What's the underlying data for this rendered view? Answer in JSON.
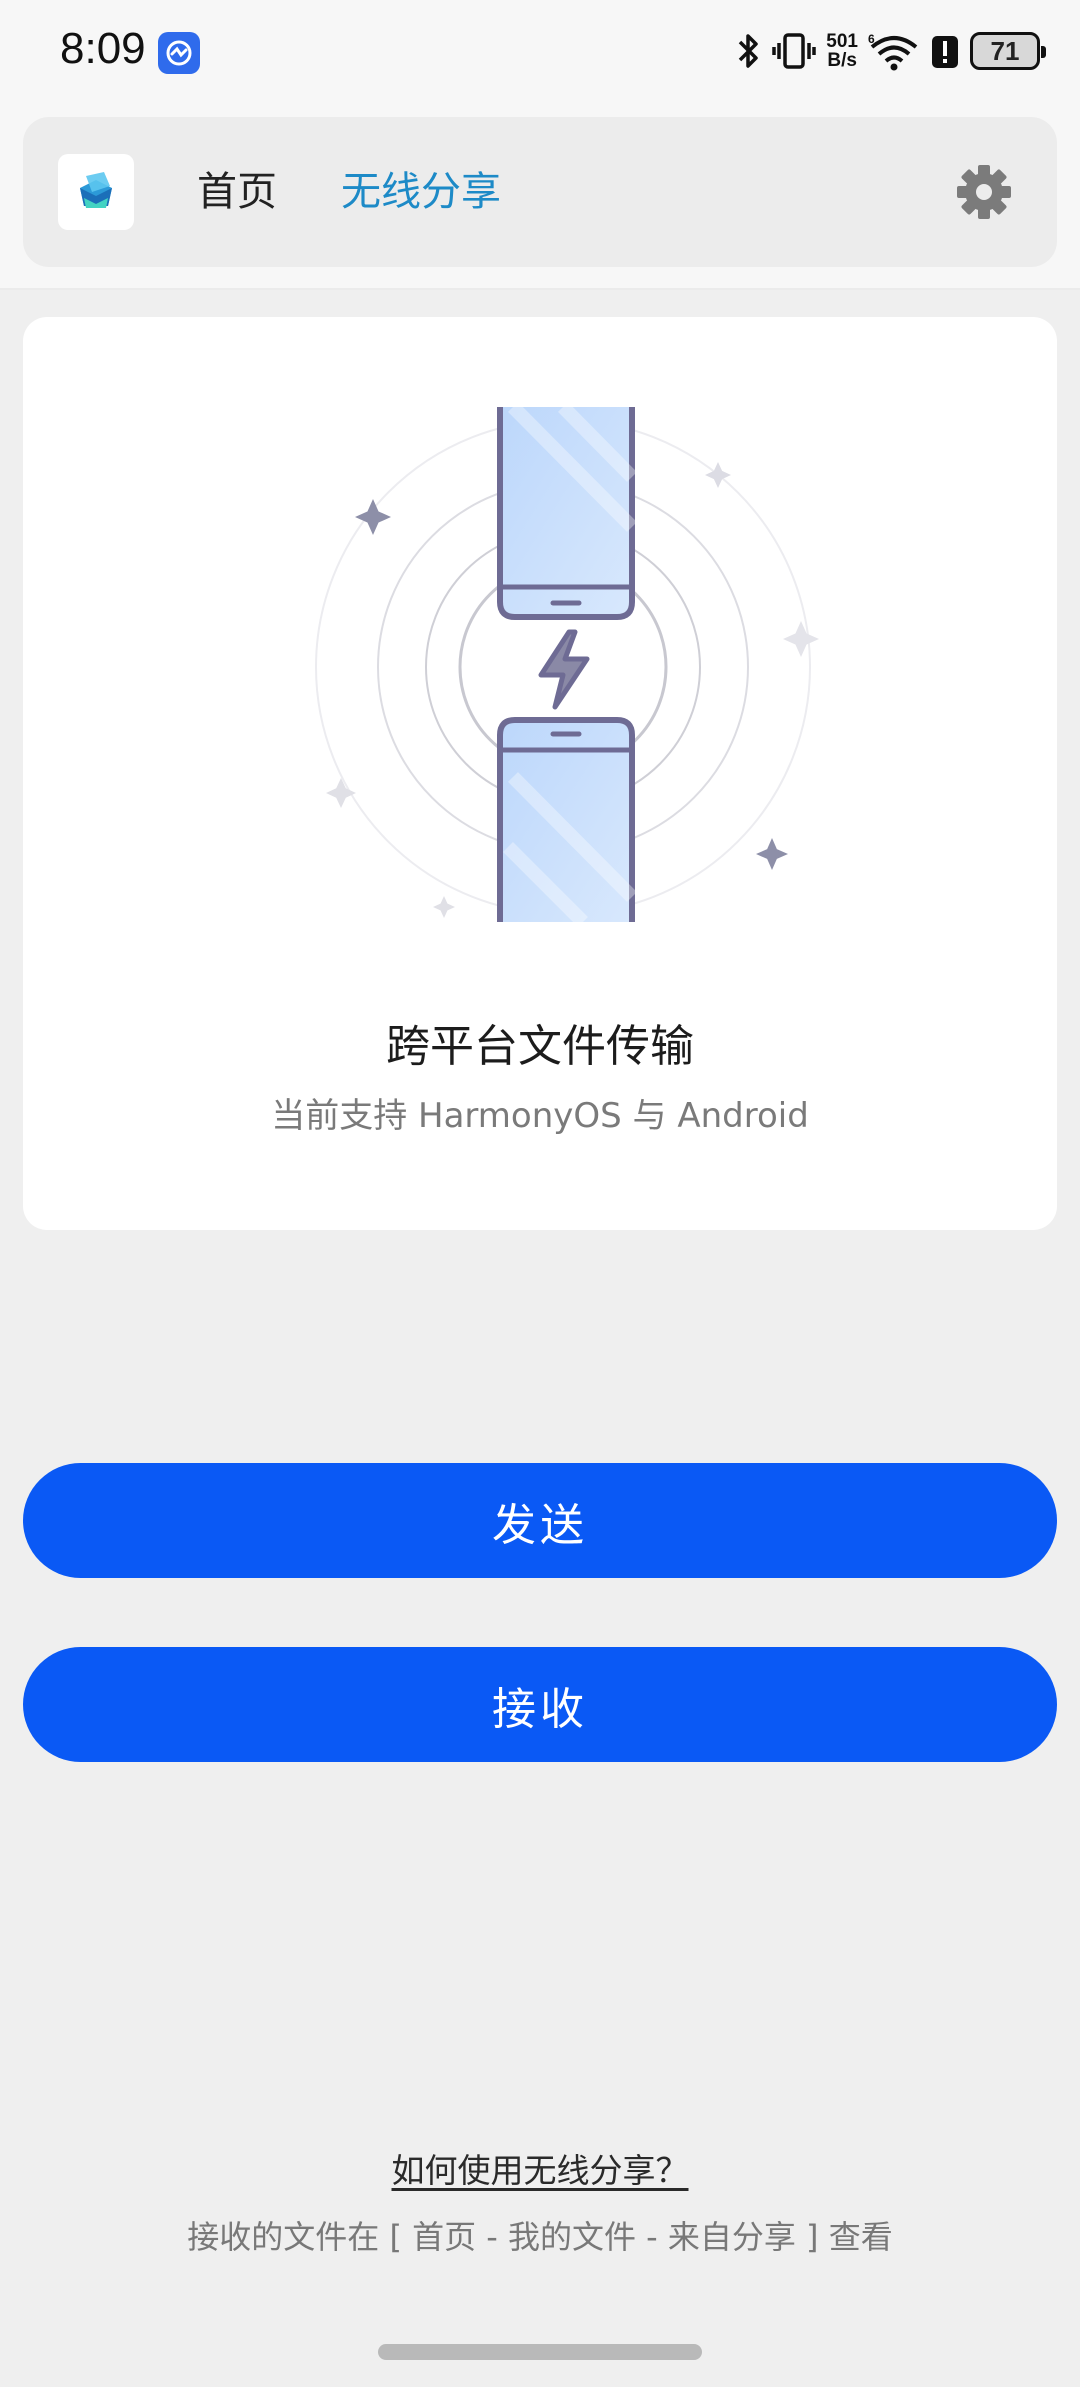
{
  "status_bar": {
    "time": "8:09",
    "net_speed_value": "501",
    "net_speed_unit": "B/s",
    "battery": "71",
    "icons": [
      "app-notification-icon",
      "bluetooth-icon",
      "vibrate-icon",
      "wifi-6-icon",
      "alert-icon",
      "battery-icon"
    ]
  },
  "header": {
    "tabs": [
      {
        "label": "首页",
        "active": false
      },
      {
        "label": "无线分享",
        "active": true
      }
    ],
    "logo_icon": "app-logo-icon",
    "settings_icon": "gear-icon",
    "accent_color": "#1d8ac7"
  },
  "hero": {
    "illustration": "phone-to-phone-transfer-icon",
    "title": "跨平台文件传输",
    "subtitle": "当前支持 HarmonyOS 与 Android"
  },
  "actions": {
    "send_label": "发送",
    "receive_label": "接收",
    "button_color": "#0a59f5"
  },
  "footer": {
    "help_link": "如何使用无线分享？",
    "note": "接收的文件在 [ 首页 - 我的文件 - 来自分享 ] 查看"
  }
}
